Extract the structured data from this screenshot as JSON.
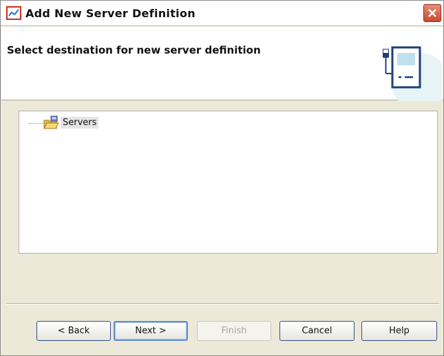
{
  "window": {
    "title": "Add New Server Definition",
    "icons": {
      "app": "chart-app-icon",
      "close": "close-icon"
    }
  },
  "header": {
    "title": "Select destination for new server definition",
    "art": "server-computer-icon"
  },
  "tree": {
    "items": [
      {
        "label": "Servers",
        "icon": "open-folder-icon",
        "selected": true
      }
    ]
  },
  "buttons": {
    "back": "< Back",
    "next": "Next >",
    "finish": "Finish",
    "cancel": "Cancel",
    "help": "Help"
  },
  "colors": {
    "accent": "#2e4d86",
    "close_red": "#c94a30",
    "focus_blue": "#5c8fd6"
  }
}
